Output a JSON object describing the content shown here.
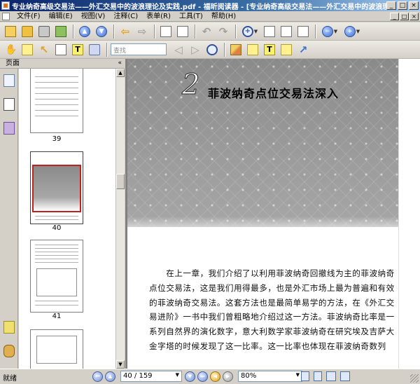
{
  "window": {
    "title": "专业纳奇高级交易法——外汇交易中的波浪理论及实践.pdf - 福昕阅读器 - [专业纳奇高级交易法——外汇交易中的波浪理论...",
    "min_glyph": "_",
    "max_glyph": "□",
    "close_glyph": "×"
  },
  "menu": {
    "items": [
      "文件(F)",
      "编辑(E)",
      "视图(V)",
      "注释(C)",
      "表单(R)",
      "工具(T)",
      "帮助(H)"
    ]
  },
  "toolbar": {
    "search_placeholder": "查找"
  },
  "panel": {
    "title": "页面",
    "collapse_glyph": "«"
  },
  "thumbnails": [
    {
      "label": "39"
    },
    {
      "label": "40"
    },
    {
      "label": "41"
    },
    {
      "label": ""
    }
  ],
  "document": {
    "chapter_number": "2",
    "chapter_title": "菲波纳奇点位交易法深入",
    "paragraph_lines": [
      "　　在上一章，我们介绍了以利用菲波纳奇回撤线为主的菲波纳奇",
      "点位交易法，这是我们用得最多，也是外汇市场上最为普遍和有效",
      "的菲波纳奇交易法。这套方法也是最简单易学的方法，在《外汇交",
      "易进阶》一书中我们曾粗略地介绍过这一方法。菲波纳奇比率是一",
      "系列自然界的演化数字，意大利数学家菲波纳奇在研究埃及吉萨大",
      "金字塔的时候发现了这一比率。这一比率也体现在菲波纳奇数列"
    ]
  },
  "status": {
    "text": "就绪",
    "page_display": "40 / 159",
    "zoom": "80%"
  },
  "colors": {
    "titlebar_start": "#0a246a",
    "selected_thumb_border": "#c02020"
  }
}
